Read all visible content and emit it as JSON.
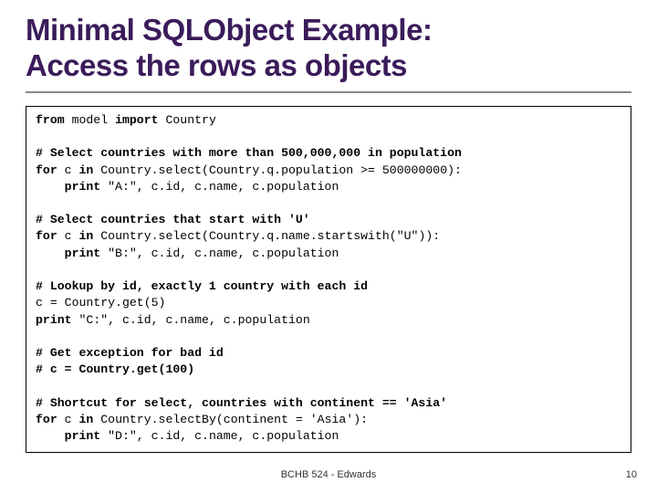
{
  "title_line1": "Minimal SQLObject Example:",
  "title_line2": "Access the rows as objects",
  "code": {
    "l1a": "from",
    "l1b": " model ",
    "l1c": "import",
    "l1d": " Country",
    "l3": "# Select countries with more than 500,000,000 in population",
    "l4a": "for",
    "l4b": " c ",
    "l4c": "in",
    "l4d": " Country.select(Country.q.population >= 500000000):",
    "l5a": "    ",
    "l5b": "print",
    "l5c": " \"A:\", c.id, c.name, c.population",
    "l7": "# Select countries that start with 'U'",
    "l8a": "for",
    "l8b": " c ",
    "l8c": "in",
    "l8d": " Country.select(Country.q.name.startswith(\"U\")):",
    "l9a": "    ",
    "l9b": "print",
    "l9c": " \"B:\", c.id, c.name, c.population",
    "l11": "# Lookup by id, exactly 1 country with each id",
    "l12": "c = Country.get(5)",
    "l13a": "print",
    "l13b": " \"C:\", c.id, c.name, c.population",
    "l15": "# Get exception for bad id",
    "l16": "# c = Country.get(100)",
    "l18": "# Shortcut for select, countries with continent == 'Asia'",
    "l19a": "for",
    "l19b": " c ",
    "l19c": "in",
    "l19d": " Country.selectBy(continent = 'Asia'):",
    "l20a": "    ",
    "l20b": "print",
    "l20c": " \"D:\", c.id, c.name, c.population"
  },
  "footer": "BCHB 524 - Edwards",
  "page_number": "10"
}
